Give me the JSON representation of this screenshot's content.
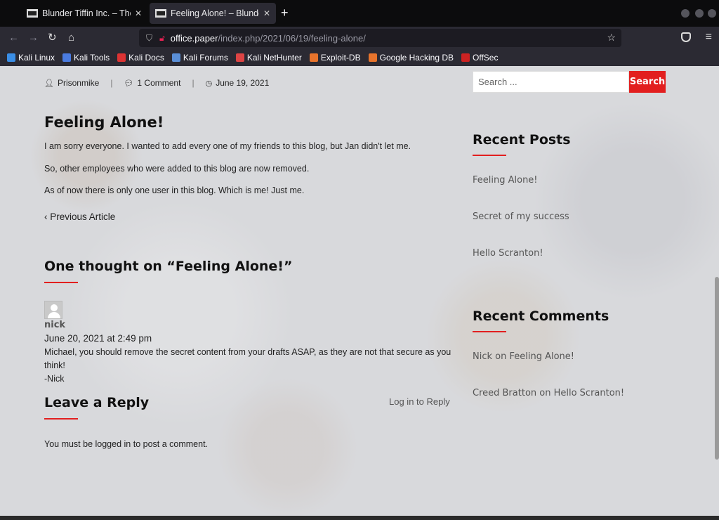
{
  "browser": {
    "tabs": [
      {
        "title": "Blunder Tiffin Inc. – The b",
        "close": "✕"
      },
      {
        "title": "Feeling Alone! – Blunder T",
        "close": "✕"
      }
    ],
    "new_tab": "+",
    "url_host": "office.paper",
    "url_path": "/index.php/2021/06/19/feeling-alone/",
    "bookmarks": [
      {
        "label": "Kali Linux",
        "color": "#3a8ee6"
      },
      {
        "label": "Kali Tools",
        "color": "#4a7be0"
      },
      {
        "label": "Kali Docs",
        "color": "#d33"
      },
      {
        "label": "Kali Forums",
        "color": "#5a8fd8"
      },
      {
        "label": "Kali NetHunter",
        "color": "#d44"
      },
      {
        "label": "Exploit-DB",
        "color": "#e8742c"
      },
      {
        "label": "Google Hacking DB",
        "color": "#e8742c"
      },
      {
        "label": "OffSec",
        "color": "#c22"
      }
    ]
  },
  "post": {
    "author": "Prisonmike",
    "comments_count": "1 Comment",
    "date": "June 19, 2021",
    "title": "Feeling Alone!",
    "paragraphs": [
      "I am sorry everyone. I wanted to add every one of my friends to this blog, but Jan didn't let me.",
      "So, other employees who were added to this blog are now removed.",
      "As of now there is only one user in this blog. Which is me! Just me."
    ],
    "previous": "‹ Previous Article"
  },
  "comments": {
    "title": "One thought on “Feeling Alone!”",
    "items": [
      {
        "author": "nick",
        "date": "June 20, 2021 at 2:49 pm",
        "body": "Michael, you should remove the secret content from your drafts ASAP, as they are not that secure as you think!",
        "signoff": "-Nick",
        "reply": "Log in to Reply"
      }
    ]
  },
  "reply_form": {
    "title": "Leave a Reply",
    "notice": "You must be logged in to post a comment."
  },
  "sidebar": {
    "search_placeholder": "Search ...",
    "search_button": "Search",
    "recent_posts_title": "Recent Posts",
    "recent_posts": [
      "Feeling Alone!",
      "Secret of my success",
      "Hello Scranton!"
    ],
    "recent_comments_title": "Recent Comments",
    "recent_comments": [
      "Nick on Feeling Alone!",
      "Creed Bratton on Hello Scranton!"
    ]
  },
  "accent_color": "#e21f1f"
}
